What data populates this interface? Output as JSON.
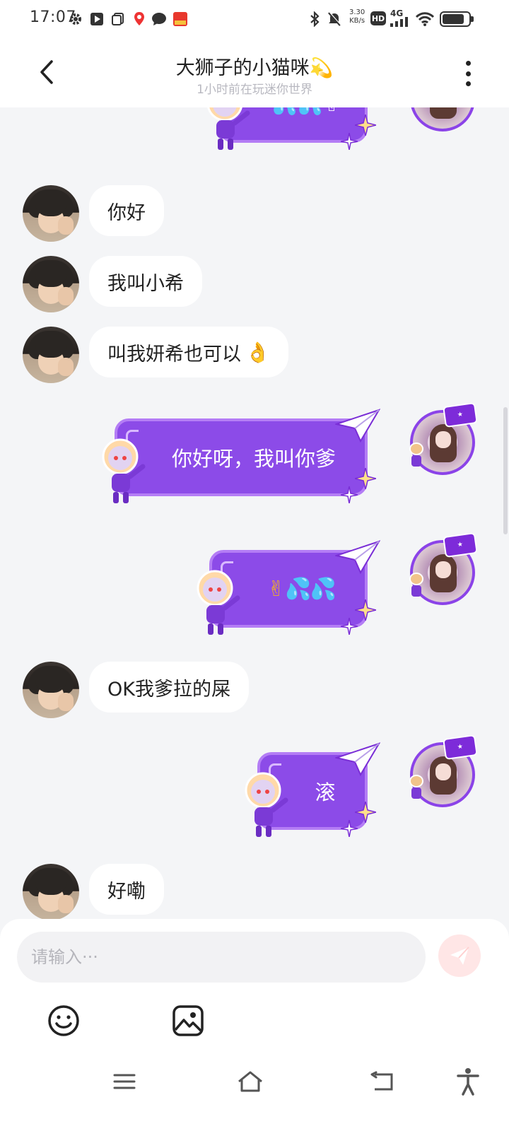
{
  "status_bar": {
    "time": "17:07",
    "net_speed_value": "3.30",
    "net_speed_unit": "KB/s",
    "hd_label": "HD",
    "network_label": "4G",
    "icons": [
      "gear-icon",
      "play-icon",
      "copy-icon",
      "location-pin-icon",
      "chat-bubble-icon",
      "app-badge-icon",
      "bluetooth-icon",
      "mute-icon",
      "wifi-icon",
      "battery-icon"
    ]
  },
  "header": {
    "title": "大狮子的小猫咪",
    "title_emoji": "💫",
    "subtitle": "1小时前在玩迷你世界"
  },
  "messages": [
    {
      "side": "right",
      "content": "💦💦✌"
    },
    {
      "side": "left",
      "text": "你好"
    },
    {
      "side": "left",
      "text": "我叫小希"
    },
    {
      "side": "left",
      "text": "叫我妍希也可以",
      "emoji": "👌"
    },
    {
      "side": "right",
      "text": "你好呀，我叫你爹"
    },
    {
      "side": "right",
      "content_v": "✌",
      "content_drops": "💦💦"
    },
    {
      "side": "left",
      "text": "OK我爹拉的屎"
    },
    {
      "side": "right",
      "text": "滚"
    },
    {
      "side": "left",
      "text": "好嘞"
    }
  ],
  "composer": {
    "placeholder": "请输入···"
  },
  "colors": {
    "bubble_purple": "#8c4be8",
    "background": "#f4f5f7",
    "send_button": "#ffe6e6"
  }
}
